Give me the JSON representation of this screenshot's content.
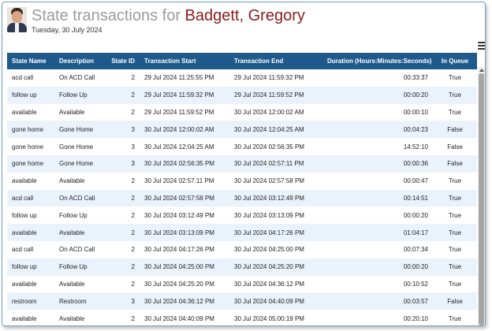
{
  "header": {
    "title_prefix": "State transactions for",
    "agent_name": "Badgett, Gregory",
    "date": "Tuesday, 30 July 2024",
    "avatar_icon": "user-photo-icon",
    "menu_icon": "hamburger-menu-icon"
  },
  "colors": {
    "header_bg": "#1e5a8c",
    "name_color": "#8b1c1c",
    "title_color": "#9b9b9b",
    "alt_row": "#eaf3fb"
  },
  "table": {
    "columns": [
      "State Name",
      "Description",
      "State ID",
      "Transaction Start",
      "Transaction End",
      "Duration (Hours:Minutes:Seconds)",
      "In Queue"
    ],
    "rows": [
      [
        "acd call",
        "On ACD Call",
        "2",
        "29 Jul 2024 11:25:55 PM",
        "29 Jul 2024 11:59:32 PM",
        "00:33:37",
        "True"
      ],
      [
        "follow up",
        "Follow Up",
        "2",
        "29 Jul 2024 11:59:32 PM",
        "29 Jul 2024 11:59:52 PM",
        "00:00:20",
        "True"
      ],
      [
        "available",
        "Available",
        "2",
        "29 Jul 2024 11:59:52 PM",
        "30 Jul 2024 12:00:02 AM",
        "00:00:10",
        "True"
      ],
      [
        "gone home",
        "Gone Home",
        "3",
        "30 Jul 2024 12:00:02 AM",
        "30 Jul 2024 12:04:25 AM",
        "00:04:23",
        "False"
      ],
      [
        "gone home",
        "Gone Home",
        "3",
        "30 Jul 2024 12:04:25 AM",
        "30 Jul 2024 02:56:35 PM",
        "14:52:10",
        "False"
      ],
      [
        "gone home",
        "Gone Home",
        "3",
        "30 Jul 2024 02:56:35 PM",
        "30 Jul 2024 02:57:11 PM",
        "00:00:36",
        "False"
      ],
      [
        "available",
        "Available",
        "2",
        "30 Jul 2024 02:57:11 PM",
        "30 Jul 2024 02:57:58 PM",
        "00:00:47",
        "True"
      ],
      [
        "acd call",
        "On ACD Call",
        "2",
        "30 Jul 2024 02:57:58 PM",
        "30 Jul 2024 03:12:49 PM",
        "00:14:51",
        "True"
      ],
      [
        "follow up",
        "Follow Up",
        "2",
        "30 Jul 2024 03:12:49 PM",
        "30 Jul 2024 03:13:09 PM",
        "00:00:20",
        "True"
      ],
      [
        "available",
        "Available",
        "2",
        "30 Jul 2024 03:13:09 PM",
        "30 Jul 2024 04:17:26 PM",
        "01:04:17",
        "True"
      ],
      [
        "acd call",
        "On ACD Call",
        "2",
        "30 Jul 2024 04:17:26 PM",
        "30 Jul 2024 04:25:00 PM",
        "00:07:34",
        "True"
      ],
      [
        "follow up",
        "Follow Up",
        "2",
        "30 Jul 2024 04:25:00 PM",
        "30 Jul 2024 04:25:20 PM",
        "00:00:20",
        "True"
      ],
      [
        "available",
        "Available",
        "2",
        "30 Jul 2024 04:25:20 PM",
        "30 Jul 2024 04:36:12 PM",
        "00:10:52",
        "True"
      ],
      [
        "restroom",
        "Restroom",
        "3",
        "30 Jul 2024 04:36:12 PM",
        "30 Jul 2024 04:40:09 PM",
        "00:03:57",
        "False"
      ],
      [
        "available",
        "Available",
        "2",
        "30 Jul 2024 04:40:09 PM",
        "30 Jul 2024 05:00:19 PM",
        "00:20:10",
        "True"
      ]
    ]
  }
}
